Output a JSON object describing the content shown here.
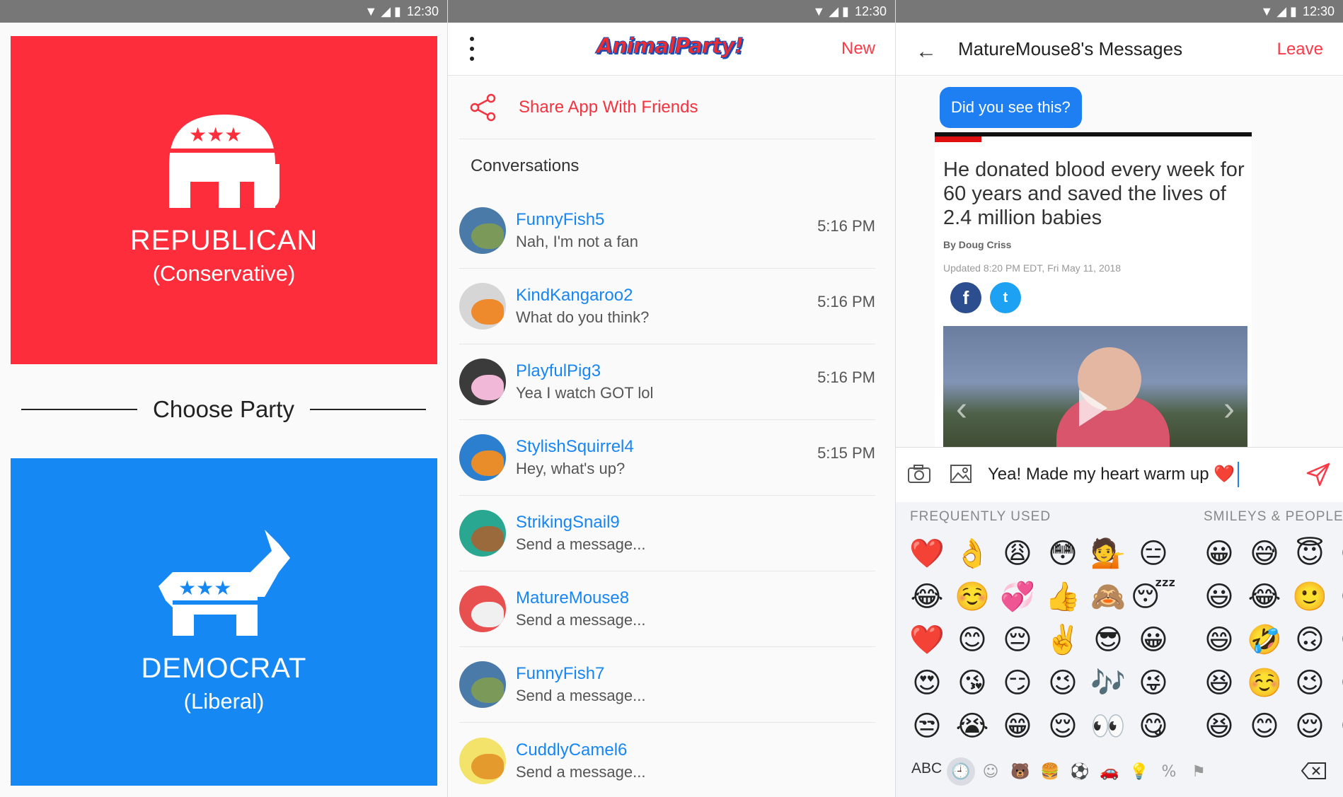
{
  "status": {
    "time": "12:30"
  },
  "party_screen": {
    "republican": {
      "name": "REPUBLICAN",
      "subtitle": "(Conservative)",
      "color": "#fd2d3c"
    },
    "divider_label": "Choose Party",
    "democrat": {
      "name": "DEMOCRAT",
      "subtitle": "(Liberal)",
      "color": "#1588f3"
    }
  },
  "conversations_screen": {
    "logo_text": "AnimalParty!",
    "new_label": "New",
    "share_label": "Share App With Friends",
    "section_label": "Conversations",
    "items": [
      {
        "name": "FunnyFish5",
        "preview": "Nah, I'm not a fan",
        "time": "5:16 PM",
        "avatar_color": "#4a7aa8",
        "animal_color": "#7b9a5a"
      },
      {
        "name": "KindKangaroo2",
        "preview": "What do you think?",
        "time": "5:16 PM",
        "avatar_color": "#d6d6d6",
        "animal_color": "#ee8a2b"
      },
      {
        "name": "PlayfulPig3",
        "preview": "Yea I watch GOT lol",
        "time": "5:16 PM",
        "avatar_color": "#3b3b3b",
        "animal_color": "#f2b8d8"
      },
      {
        "name": "StylishSquirrel4",
        "preview": "Hey, what's up?",
        "time": "5:15 PM",
        "avatar_color": "#2c7fce",
        "animal_color": "#e88d2a"
      },
      {
        "name": "StrikingSnail9",
        "preview": "Send a message...",
        "time": "",
        "avatar_color": "#2aa790",
        "animal_color": "#9b6a3c"
      },
      {
        "name": "MatureMouse8",
        "preview": "Send a message...",
        "time": "",
        "avatar_color": "#e85050",
        "animal_color": "#f0f0f0"
      },
      {
        "name": "FunnyFish7",
        "preview": "Send a message...",
        "time": "",
        "avatar_color": "#4a7aa8",
        "animal_color": "#7b9a5a"
      },
      {
        "name": "CuddlyCamel6",
        "preview": "Send a message...",
        "time": "",
        "avatar_color": "#f3e36a",
        "animal_color": "#e49a2c"
      }
    ]
  },
  "messages_screen": {
    "title": "MatureMouse8's Messages",
    "leave_label": "Leave",
    "bubble_text": "Did you see this?",
    "article": {
      "title": "He donated blood every week for 60 years and saved the lives of 2.4 million babies",
      "byline": "By Doug Criss",
      "updated": "Updated 8:20 PM EDT, Fri May 11, 2018",
      "facebook_glyph": "f",
      "twitter_glyph": "t"
    },
    "composer_text": "Yea! Made my heart warm up ❤️",
    "keyboard": {
      "frequent_label": "FREQUENTLY USED",
      "smileys_label": "SMILEYS & PEOPLE",
      "frequent": [
        "❤️",
        "👌",
        "😩",
        "😳",
        "💁",
        "😑",
        "😂",
        "☺️",
        "💞",
        "👍",
        "🙈",
        "😴",
        "❤️",
        "😊",
        "😔",
        "✌️",
        "😎",
        "😀",
        "😍",
        "😘",
        "😏",
        "😉",
        "🎶",
        "😜",
        "😒",
        "😭",
        "😁",
        "😌",
        "👀",
        "😋"
      ],
      "smileys": [
        "😀",
        "😅",
        "😇",
        "😁",
        "😃",
        "😂",
        "🙂",
        "😜",
        "😄",
        "🤣",
        "🙃",
        "😀",
        "😆",
        "☺️",
        "😉",
        "😁",
        "😆",
        "😊",
        "😌",
        "😀"
      ],
      "abc_label": "ABC",
      "tabs": [
        "🕘",
        "☺",
        "🐻",
        "🍔",
        "⚽",
        "🚗",
        "💡",
        "%",
        "⚑"
      ]
    },
    "accent_color": "#1e7ff3"
  }
}
